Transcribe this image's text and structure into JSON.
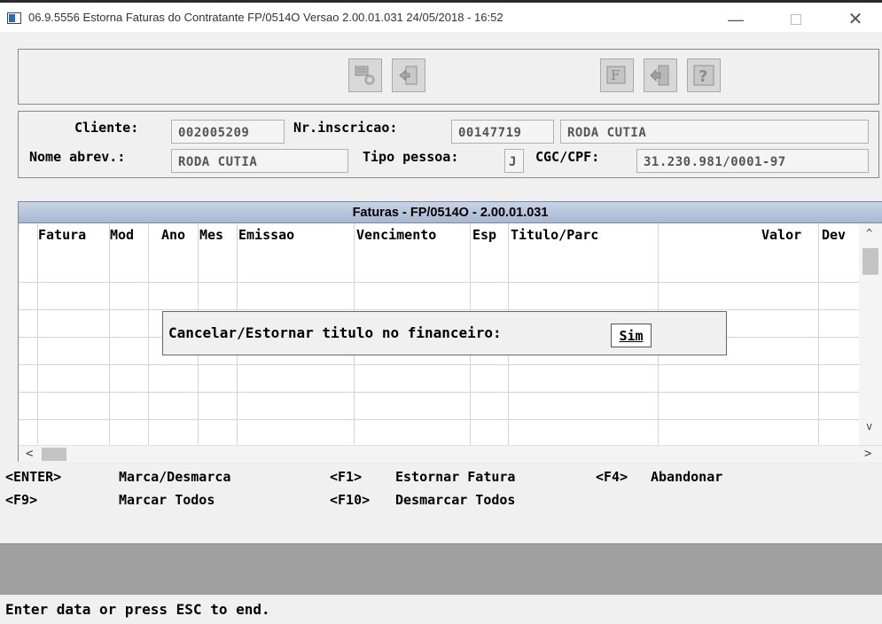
{
  "window": {
    "title": "06.9.5556  Estorna Faturas do Contratante FP/0514O Versao 2.00.01.031 24/05/2018 - 16:52",
    "minimize": "—",
    "close": "✕"
  },
  "toolbar": {
    "icons": [
      "process-icon",
      "exit-document-icon",
      "f-function-icon",
      "exit-door-icon",
      "help-icon"
    ]
  },
  "header": {
    "cliente_label": "Cliente:",
    "cliente_value": "002005209",
    "nr_inscricao_label": "Nr.inscricao:",
    "nr_inscricao_value": "00147719",
    "cliente_nome": "RODA CUTIA",
    "nome_abrev_label": "Nome abrev.:",
    "nome_abrev_value": "RODA CUTIA",
    "tipo_pessoa_label": "Tipo pessoa:",
    "tipo_pessoa_value": "J",
    "cgc_cpf_label": "CGC/CPF:",
    "cgc_cpf_value": "31.230.981/0001-97"
  },
  "grid": {
    "title": "Faturas - FP/0514O - 2.00.01.031",
    "columns": [
      "Fatura",
      "Mod",
      "Ano",
      "Mes",
      "Emissao",
      "Vencimento",
      "Esp",
      "Titulo/Parc",
      "Valor",
      "Dev"
    ],
    "scroll_up": "^",
    "scroll_down": "v",
    "scroll_left": "<",
    "scroll_right": ">"
  },
  "popup": {
    "label": "Cancelar/Estornar titulo no financeiro:",
    "value": "Sim"
  },
  "shortcuts": {
    "enter_key": "<ENTER>",
    "enter_action": "Marca/Desmarca",
    "f1_key": "<F1>",
    "f1_action": "Estornar Fatura",
    "f4_key": "<F4>",
    "f4_action": "Abandonar",
    "f9_key": "<F9>",
    "f9_action": "Marcar Todos",
    "f10_key": "<F10>",
    "f10_action": "Desmarcar Todos"
  },
  "status": {
    "message": "Enter data or press ESC to end."
  }
}
